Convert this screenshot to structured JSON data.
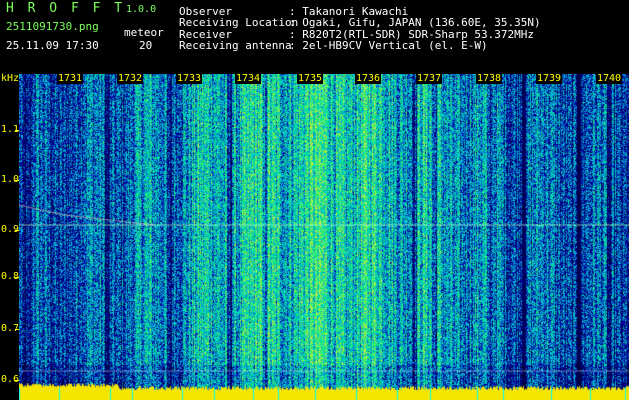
{
  "app": {
    "title": "H R O F F T",
    "version": "1.0.0"
  },
  "file": {
    "name": "2511091730.png",
    "datetime": "25.11.09 17:30"
  },
  "meteor": {
    "label": "meteor",
    "count": "20"
  },
  "info": [
    {
      "key": "Observer",
      "value": ": Takanori Kawachi"
    },
    {
      "key": "Receiving Location",
      "value": ": Ogaki, Gifu, JAPAN (136.60E, 35.35N)"
    },
    {
      "key": "Receiver",
      "value": ": R820T2(RTL-SDR) SDR-Sharp 53.372MHz"
    },
    {
      "key": "Receiving antenna",
      "value": ": 2el-HB9CV Vertical (el. E-W)"
    }
  ],
  "axis": {
    "unit": "kHz",
    "freq_ticks": [
      "1.1",
      "1.0",
      "0.9",
      "0.8",
      "0.7",
      "0.6"
    ],
    "time_ticks": [
      "1731",
      "1732",
      "1733",
      "1734",
      "1735",
      "1736",
      "1737",
      "1738",
      "1739",
      "1740"
    ]
  },
  "colors": {
    "text_green": "#7dff5a",
    "text_white": "#ffffff",
    "axis_yellow": "#ffff00"
  },
  "chart_data": {
    "type": "heatmap",
    "xlabel": "",
    "ylabel": "kHz",
    "x_ticks": [
      "1731",
      "1732",
      "1733",
      "1734",
      "1735",
      "1736",
      "1737",
      "1738",
      "1739",
      "1740"
    ],
    "y_ticks": [
      1.1,
      1.0,
      0.9,
      0.8,
      0.7,
      0.6
    ],
    "carrier_khz": 0.91,
    "series": [
      {
        "values": [
          0.95,
          0.93,
          0.92,
          0.91
        ]
      }
    ]
  }
}
